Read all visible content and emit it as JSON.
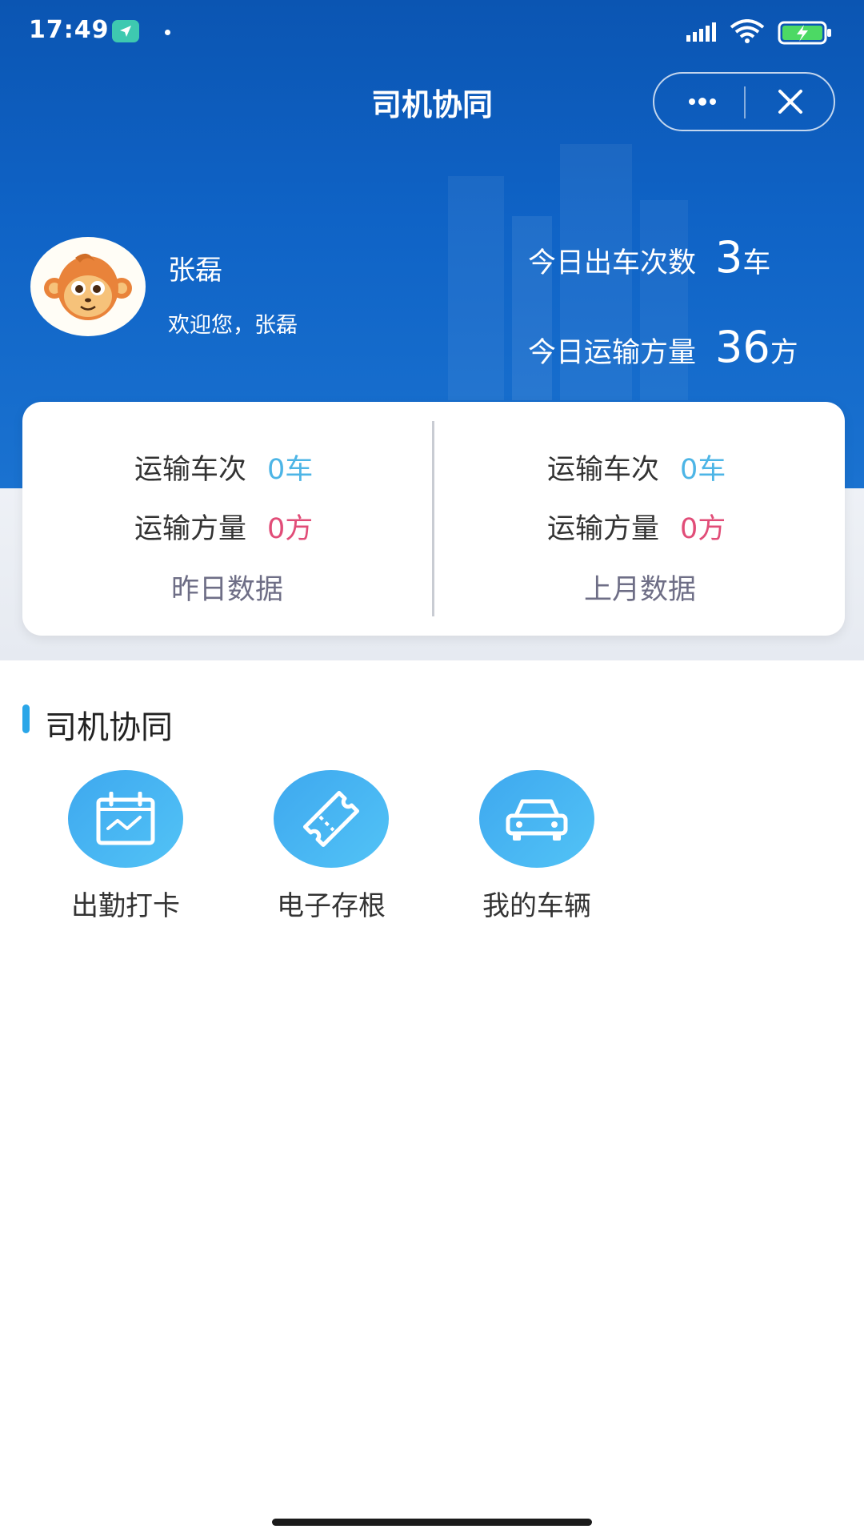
{
  "status_bar": {
    "time": "17:49",
    "icons": [
      "navigation-icon",
      "signal-icon",
      "wifi-icon",
      "battery-charging-icon"
    ]
  },
  "header": {
    "title": "司机协同",
    "capsule_icons": [
      "more-icon",
      "close-icon"
    ]
  },
  "profile": {
    "name": "张磊",
    "welcome": "欢迎您，张磊",
    "avatar_icon": "monkey-avatar-icon"
  },
  "today": {
    "trips_label": "今日出车次数",
    "trips_value": "3",
    "trips_unit": "车",
    "volume_label": "今日运输方量",
    "volume_value": "36",
    "volume_unit": "方"
  },
  "stats": [
    {
      "trips_label": "运输车次",
      "trips_value": "0车",
      "volume_label": "运输方量",
      "volume_value": "0方",
      "caption": "昨日数据"
    },
    {
      "trips_label": "运输车次",
      "trips_value": "0车",
      "volume_label": "运输方量",
      "volume_value": "0方",
      "caption": "上月数据"
    }
  ],
  "section": {
    "title": "司机协同",
    "items": [
      {
        "label": "出勤打卡",
        "icon": "calendar-chart-icon"
      },
      {
        "label": "电子存根",
        "icon": "ticket-icon"
      },
      {
        "label": "我的车辆",
        "icon": "car-icon"
      }
    ]
  },
  "colors": {
    "header_blue": "#0f63c6",
    "accent_blue": "#4db5e6",
    "accent_red": "#e14d78",
    "section_bar": "#2aa6e8"
  }
}
